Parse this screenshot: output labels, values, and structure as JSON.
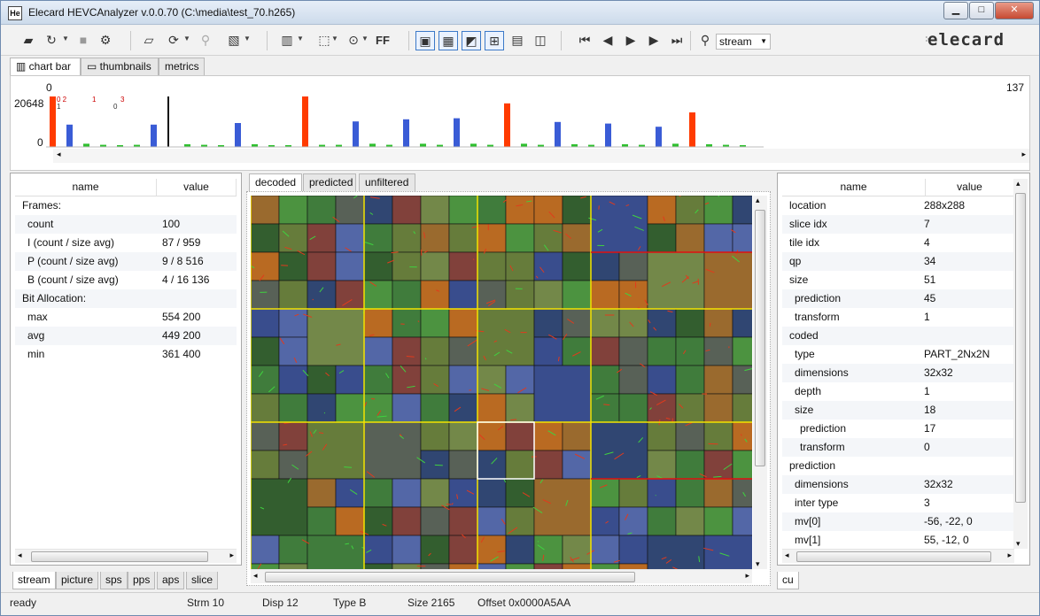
{
  "window": {
    "title": "Elecard HEVCAnalyzer v.0.0.70 (C:\\media\\test_70.h265)",
    "app_icon_text": "He",
    "min_label": "▁",
    "max_label": "□",
    "close_label": "✕"
  },
  "toolbar": {
    "stream_value": "stream",
    "ff_label": "FF",
    "logo_text": "elecard"
  },
  "top_tabs": [
    "chart bar",
    "thumbnails",
    "metrics"
  ],
  "chart": {
    "ymax_label": "20648",
    "ymin_label": "0",
    "top_left_label": "0",
    "top_right_label": "137",
    "markers": [
      "0 2",
      "1",
      "1",
      "3",
      "0"
    ],
    "bars": [
      {
        "h": 0.95,
        "c": "#ff3b00"
      },
      {
        "h": 0.42,
        "c": "#3a5cd6"
      },
      {
        "h": 0.06,
        "c": "#2fbf2f"
      },
      {
        "h": 0.04,
        "c": "#2fbf2f"
      },
      {
        "h": 0.03,
        "c": "#2fbf2f"
      },
      {
        "h": 0.04,
        "c": "#2fbf2f"
      },
      {
        "h": 0.42,
        "c": "#3a5cd6"
      },
      {
        "h": 0.95,
        "c": "#111"
      },
      {
        "h": 0.05,
        "c": "#2fbf2f"
      },
      {
        "h": 0.04,
        "c": "#2fbf2f"
      },
      {
        "h": 0.03,
        "c": "#2fbf2f"
      },
      {
        "h": 0.45,
        "c": "#3a5cd6"
      },
      {
        "h": 0.05,
        "c": "#2fbf2f"
      },
      {
        "h": 0.03,
        "c": "#2fbf2f"
      },
      {
        "h": 0.03,
        "c": "#2fbf2f"
      },
      {
        "h": 0.95,
        "c": "#ff3b00"
      },
      {
        "h": 0.04,
        "c": "#2fbf2f"
      },
      {
        "h": 0.04,
        "c": "#2fbf2f"
      },
      {
        "h": 0.48,
        "c": "#3a5cd6"
      },
      {
        "h": 0.06,
        "c": "#2fbf2f"
      },
      {
        "h": 0.04,
        "c": "#2fbf2f"
      },
      {
        "h": 0.52,
        "c": "#3a5cd6"
      },
      {
        "h": 0.06,
        "c": "#2fbf2f"
      },
      {
        "h": 0.04,
        "c": "#2fbf2f"
      },
      {
        "h": 0.54,
        "c": "#3a5cd6"
      },
      {
        "h": 0.06,
        "c": "#2fbf2f"
      },
      {
        "h": 0.04,
        "c": "#2fbf2f"
      },
      {
        "h": 0.82,
        "c": "#ff3b00"
      },
      {
        "h": 0.06,
        "c": "#2fbf2f"
      },
      {
        "h": 0.04,
        "c": "#2fbf2f"
      },
      {
        "h": 0.47,
        "c": "#3a5cd6"
      },
      {
        "h": 0.05,
        "c": "#2fbf2f"
      },
      {
        "h": 0.04,
        "c": "#2fbf2f"
      },
      {
        "h": 0.44,
        "c": "#3a5cd6"
      },
      {
        "h": 0.05,
        "c": "#2fbf2f"
      },
      {
        "h": 0.04,
        "c": "#2fbf2f"
      },
      {
        "h": 0.38,
        "c": "#3a5cd6"
      },
      {
        "h": 0.06,
        "c": "#2fbf2f"
      },
      {
        "h": 0.65,
        "c": "#ff3b00"
      },
      {
        "h": 0.05,
        "c": "#2fbf2f"
      },
      {
        "h": 0.04,
        "c": "#2fbf2f"
      },
      {
        "h": 0.03,
        "c": "#2fbf2f"
      }
    ]
  },
  "left_panel": {
    "col_name": "name",
    "col_value": "value",
    "rows": [
      {
        "n": "Frames:",
        "v": ""
      },
      {
        "n": "count",
        "v": "100",
        "i": 1
      },
      {
        "n": "I (count / size avg)",
        "v": "87 / 959",
        "i": 1
      },
      {
        "n": "P (count / size avg)",
        "v": "9 / 8 516",
        "i": 1
      },
      {
        "n": "B (count / size avg)",
        "v": "4 / 16 136",
        "i": 1
      },
      {
        "n": "Bit Allocation:",
        "v": ""
      },
      {
        "n": "max",
        "v": "554 200",
        "i": 1
      },
      {
        "n": "avg",
        "v": "449 200",
        "i": 1
      },
      {
        "n": "min",
        "v": "361 400",
        "i": 1
      }
    ],
    "tabs": [
      "stream",
      "picture",
      "sps",
      "pps",
      "aps",
      "slice"
    ]
  },
  "center_panel": {
    "tabs": [
      "decoded",
      "predicted",
      "unfiltered"
    ]
  },
  "right_panel": {
    "col_name": "name",
    "col_value": "value",
    "rows": [
      {
        "n": "location",
        "v": "288x288"
      },
      {
        "n": "slice idx",
        "v": "7"
      },
      {
        "n": "tile idx",
        "v": "4"
      },
      {
        "n": "qp",
        "v": "34"
      },
      {
        "n": "size",
        "v": "51"
      },
      {
        "n": "prediction",
        "v": "45",
        "i": 1
      },
      {
        "n": "transform",
        "v": "1",
        "i": 1
      },
      {
        "n": "coded",
        "v": ""
      },
      {
        "n": "type",
        "v": "PART_2Nx2N",
        "i": 1
      },
      {
        "n": "dimensions",
        "v": "32x32",
        "i": 1
      },
      {
        "n": "depth",
        "v": "1",
        "i": 1
      },
      {
        "n": "size",
        "v": "18",
        "i": 1
      },
      {
        "n": "prediction",
        "v": "17",
        "i": 2
      },
      {
        "n": "transform",
        "v": "0",
        "i": 2
      },
      {
        "n": "prediction",
        "v": ""
      },
      {
        "n": "dimensions",
        "v": "32x32",
        "i": 1
      },
      {
        "n": "inter type",
        "v": "3",
        "i": 1
      },
      {
        "n": "mv[0]",
        "v": "-56, -22, 0",
        "i": 1
      },
      {
        "n": "mv[1]",
        "v": "55, -12, 0",
        "i": 1
      }
    ],
    "tabs": [
      "cu"
    ]
  },
  "status": {
    "state": "ready",
    "strm": "Strm 10",
    "disp": "Disp 12",
    "type": "Type B",
    "size": "Size 2165",
    "offset": "Offset 0x0000A5AA"
  }
}
